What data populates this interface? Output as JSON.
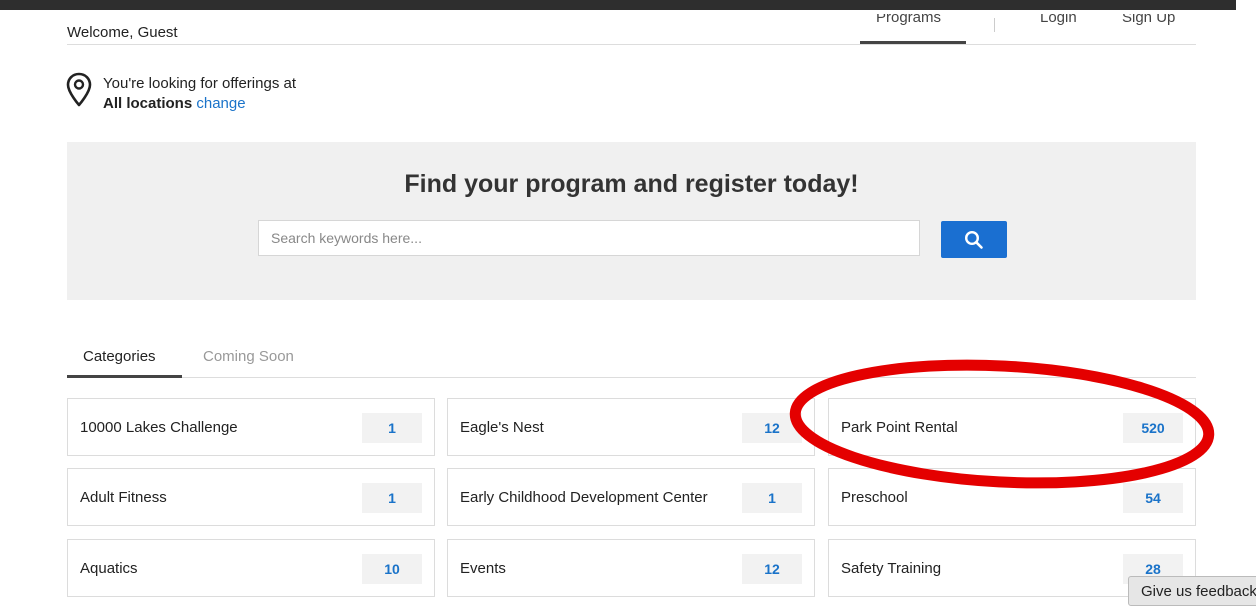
{
  "header": {
    "welcome": "Welcome, Guest",
    "nav": {
      "programs": "Programs",
      "login": "Login",
      "signup": "Sign Up"
    }
  },
  "location": {
    "line1": "You're looking for offerings at",
    "current": "All locations",
    "change_link": "change",
    "icon": "map-pin-icon"
  },
  "hero": {
    "title": "Find your program and register today!",
    "search_placeholder": "Search keywords here...",
    "search_icon": "search-icon"
  },
  "tabs": [
    "Categories",
    "Coming Soon"
  ],
  "categories": [
    {
      "label": "10000 Lakes Challenge",
      "count": "1"
    },
    {
      "label": "Eagle's Nest",
      "count": "12"
    },
    {
      "label": "Park Point Rental",
      "count": "520"
    },
    {
      "label": "Adult Fitness",
      "count": "1"
    },
    {
      "label": "Early Childhood Development Center",
      "count": "1"
    },
    {
      "label": "Preschool",
      "count": "54"
    },
    {
      "label": "Aquatics",
      "count": "10"
    },
    {
      "label": "Events",
      "count": "12"
    },
    {
      "label": "Safety Training",
      "count": "28"
    }
  ],
  "feedback": {
    "label": "Give us feedback"
  },
  "colors": {
    "accent": "#1a6fd1",
    "link": "#1a73c9",
    "annotation": "#e40000",
    "hero_bg": "#f0f0f0"
  }
}
